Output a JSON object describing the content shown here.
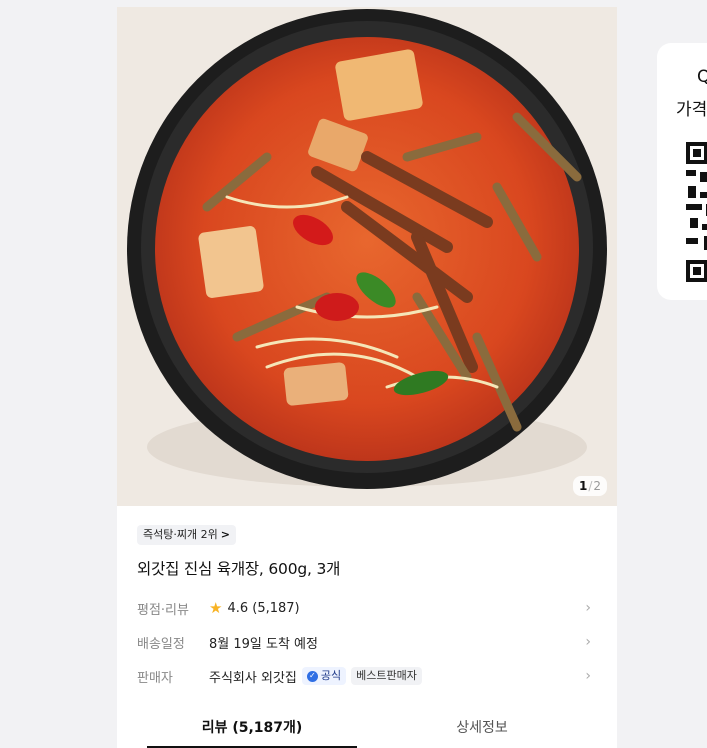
{
  "image": {
    "counter_current": "1",
    "counter_separator": "/",
    "counter_total": "2"
  },
  "product": {
    "category_chip": "즉석탕·찌개 2위",
    "title": "외갓집 진심 육개장, 600g, 3개"
  },
  "info_rows": {
    "rating": {
      "label": "평점·리뷰",
      "value": "4.6 (5,187)"
    },
    "delivery": {
      "label": "배송일정",
      "value": "8월 19일 도착 예정"
    },
    "seller": {
      "label": "판매자",
      "value": "주식회사 외갓집",
      "badge_official": "공식",
      "badge_best": "베스트판매자"
    }
  },
  "tabs": {
    "reviews": "리뷰 (5,187개)",
    "details": "상세정보"
  },
  "qr_panel": {
    "line1": "Q",
    "line2": "가격"
  },
  "colors": {
    "star": "#f8b324",
    "official_check": "#2f6fe4",
    "soup": "#d9471f",
    "bowl": "#222222"
  }
}
